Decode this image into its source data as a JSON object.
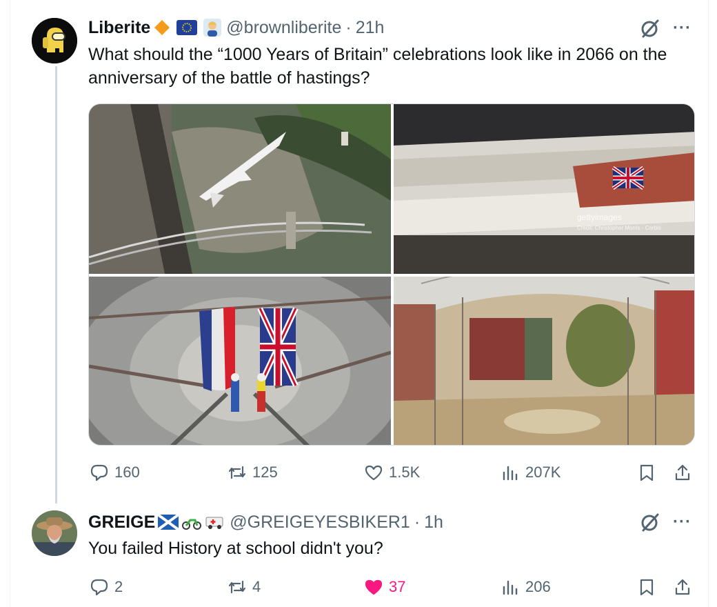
{
  "post": {
    "author_name": "Liberite",
    "handle": "@brownliberite",
    "separator": "·",
    "time": "21h",
    "text": "What should the “1000 Years of Britain” celebrations look like in 2066 on the anniversary of the battle of hastings?",
    "watermark_brand": "gettyimages",
    "watermark_credit": "Credit: Christopher Morris - Corbis",
    "stats": {
      "replies": "160",
      "reposts": "125",
      "likes": "1.5K",
      "views": "207K"
    },
    "more_label": "···"
  },
  "reply": {
    "author_name": "GREIGE",
    "handle": "@GREIGEYESBIKER1",
    "separator": "·",
    "time": "1h",
    "text": "You failed History at school didn't you?",
    "stats": {
      "replies": "2",
      "reposts": "4",
      "likes": "37",
      "views": "206"
    },
    "more_label": "···"
  },
  "colors": {
    "text": "#0f1419",
    "muted": "#536471",
    "like_active": "#f91880",
    "border": "#cfd9de"
  },
  "icons": [
    "grok-icon",
    "more-icon",
    "reply-icon",
    "repost-icon",
    "like-icon",
    "views-icon",
    "bookmark-icon",
    "share-icon",
    "gold-diamond-icon",
    "eu-flag-icon",
    "person-emoji-icon",
    "scotland-flag-icon",
    "motorbike-emoji-icon",
    "ambulance-emoji-icon"
  ]
}
